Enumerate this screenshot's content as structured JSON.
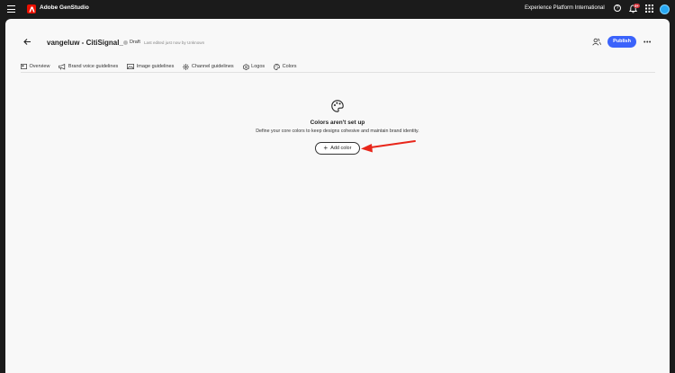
{
  "topbar": {
    "app_title": "Adobe GenStudio",
    "org_name": "Experience Platform International",
    "notification_badge": "9+"
  },
  "header": {
    "title": "vangeluw - CitiSignal_",
    "status": "Draft",
    "last_edited": "Last edited just now by Unknown",
    "publish_label": "Publish",
    "more_label": "•••"
  },
  "tabs": [
    {
      "label": "Overview",
      "icon": "overview-icon"
    },
    {
      "label": "Brand voice guidelines",
      "icon": "megaphone-icon"
    },
    {
      "label": "Image guidelines",
      "icon": "image-icon"
    },
    {
      "label": "Channel guidelines",
      "icon": "channels-icon"
    },
    {
      "label": "Logos",
      "icon": "logo-icon"
    },
    {
      "label": "Colors",
      "icon": "palette-icon",
      "active": true
    }
  ],
  "empty_state": {
    "icon": "palette-icon",
    "title": "Colors aren't set up",
    "description": "Define your core colors to keep designs cohesive and maintain brand identity.",
    "button_label": "Add color"
  },
  "colors": {
    "accent": "#3b63fb",
    "topbar_bg": "#1b1b1b",
    "annotation_arrow": "#e8261a"
  }
}
